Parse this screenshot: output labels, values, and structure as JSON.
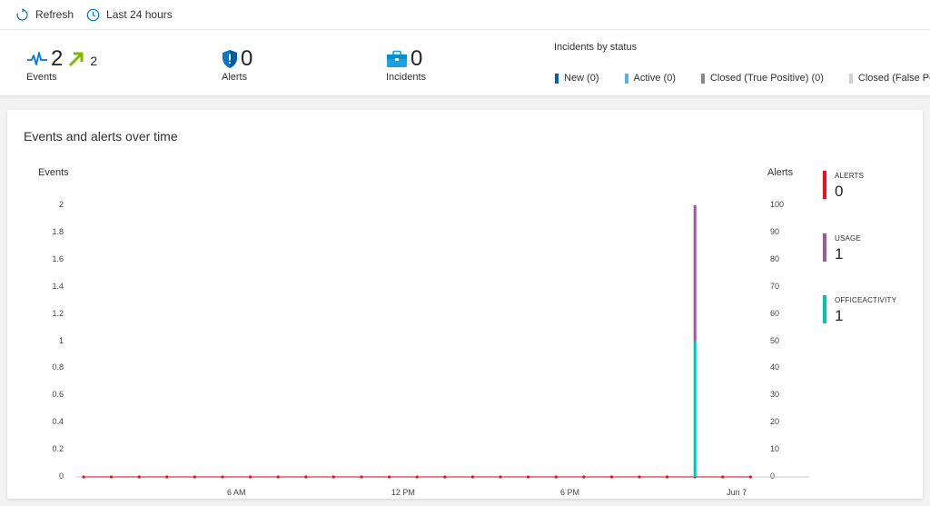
{
  "toolbar": {
    "refresh_label": "Refresh",
    "timerange_label": "Last 24 hours"
  },
  "summary": {
    "events": {
      "value": "2",
      "delta": "2",
      "label": "Events"
    },
    "alerts": {
      "value": "0",
      "label": "Alerts"
    },
    "incidents": {
      "value": "0",
      "label": "Incidents"
    },
    "status": {
      "title": "Incidents by status",
      "items": [
        {
          "label": "New (0)",
          "color": "#0063b1"
        },
        {
          "label": "Active (0)",
          "color": "#4fb3f6"
        },
        {
          "label": "Closed (True Positive) (0)",
          "color": "#8a8886"
        },
        {
          "label": "Closed (False Po",
          "color": "#d2d0ce"
        }
      ]
    }
  },
  "card": {
    "title": "Events and alerts over time"
  },
  "chart_data": {
    "type": "bar",
    "title": "Events and alerts over time",
    "ylabel": "Events",
    "y2label": "Alerts",
    "ylim": [
      0,
      2
    ],
    "y2lim": [
      0,
      100
    ],
    "y_ticks": [
      "0",
      "0.2",
      "0.4",
      "0.6",
      "0.8",
      "1",
      "1.2",
      "1.4",
      "1.6",
      "1.8",
      "2"
    ],
    "y2_ticks": [
      "0",
      "10",
      "20",
      "30",
      "40",
      "50",
      "60",
      "70",
      "80",
      "90",
      "100"
    ],
    "x_ticks": [
      "6 AM",
      "12 PM",
      "6 PM",
      "Jun 7"
    ],
    "x_tick_slots": [
      5.5,
      11.5,
      17.5,
      23.5
    ],
    "slots": 25,
    "alert_points": [
      0,
      0,
      0,
      0,
      0,
      0,
      0,
      0,
      0,
      0,
      0,
      0,
      0,
      0,
      0,
      0,
      0,
      0,
      0,
      0,
      0,
      0,
      0,
      0,
      0
    ],
    "stacked_bar": {
      "slot": 22,
      "segments": [
        {
          "name": "OFFICEACTIVITY",
          "value": 1,
          "color": "#00c2b8"
        },
        {
          "name": "USAGE",
          "value": 1,
          "color": "#a056a8"
        }
      ]
    },
    "grid": false,
    "legend_position": "right",
    "colors": {
      "alerts": "#e81123",
      "usage": "#a056a8",
      "officeactivity": "#00c2b8"
    }
  },
  "legend": [
    {
      "name": "ALERTS",
      "value": "0",
      "color": "#e81123"
    },
    {
      "name": "USAGE",
      "value": "1",
      "color": "#a056a8"
    },
    {
      "name": "OFFICEACTIVITY",
      "value": "1",
      "color": "#00c2b8"
    }
  ]
}
